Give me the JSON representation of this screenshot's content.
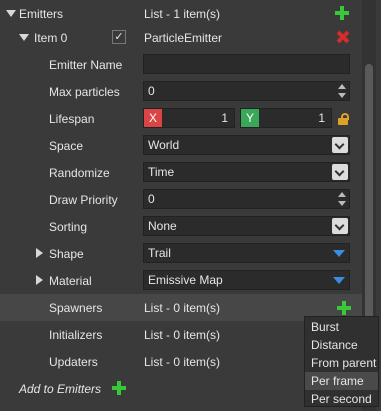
{
  "properties": {
    "emitters": {
      "label": "Emitters",
      "value": "List - 1 item(s)"
    },
    "item0": {
      "label": "Item 0",
      "checked": true,
      "value": "ParticleEmitter"
    },
    "emitter_name": {
      "label": "Emitter Name",
      "value": ""
    },
    "max_particles": {
      "label": "Max particles",
      "value": "0"
    },
    "lifespan": {
      "label": "Lifespan",
      "x_tag": "X",
      "x_value": "1",
      "y_tag": "Y",
      "y_value": "1"
    },
    "space": {
      "label": "Space",
      "value": "World"
    },
    "randomize": {
      "label": "Randomize",
      "value": "Time"
    },
    "draw_priority": {
      "label": "Draw Priority",
      "value": "0"
    },
    "sorting": {
      "label": "Sorting",
      "value": "None"
    },
    "shape": {
      "label": "Shape",
      "value": "Trail"
    },
    "material": {
      "label": "Material",
      "value": "Emissive Map"
    },
    "spawners": {
      "label": "Spawners",
      "value": "List - 0 item(s)"
    },
    "initializers": {
      "label": "Initializers",
      "value": "List - 0 item(s)"
    },
    "updaters": {
      "label": "Updaters",
      "value": "List - 0 item(s)"
    },
    "add_to_emitters": {
      "label": "Add to Emitters"
    }
  },
  "context_menu": {
    "items": [
      "Burst",
      "Distance",
      "From parent",
      "Per frame",
      "Per second"
    ],
    "hovered": "Per frame"
  },
  "icons": {
    "add": "plus-icon",
    "remove": "x-icon",
    "lock": "lock-icon"
  },
  "colors": {
    "add_green": "#39c839",
    "remove_red": "#d42d2d",
    "x_tag": "#d94444",
    "y_tag": "#3aa858",
    "dropdown_blue": "#3b8be0",
    "lock_orange": "#e0a12a"
  }
}
